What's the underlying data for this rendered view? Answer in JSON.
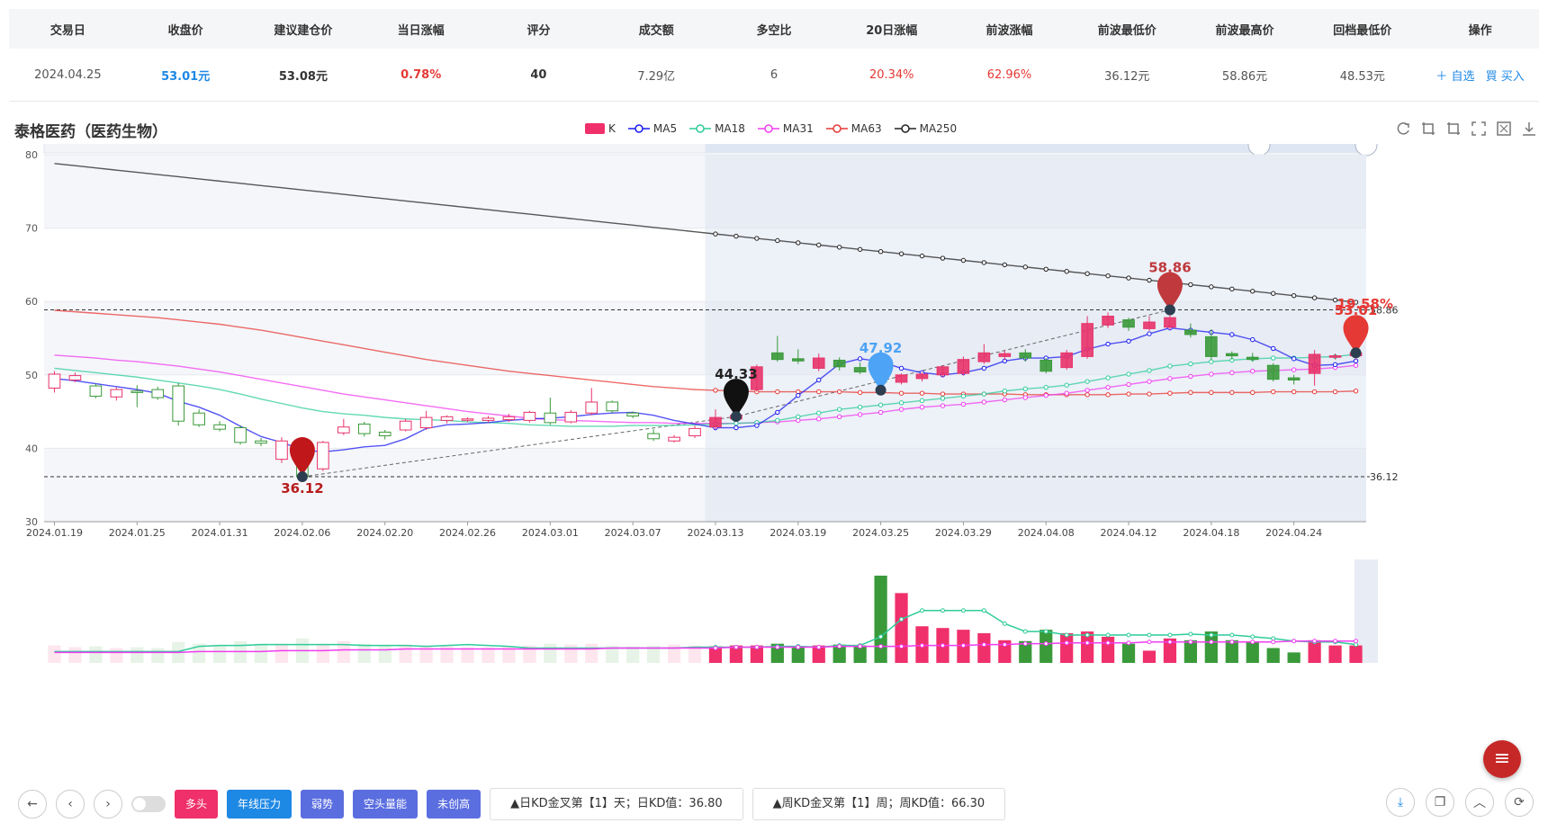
{
  "table": {
    "headers": [
      "交易日",
      "收盘价",
      "建议建仓价",
      "当日涨幅",
      "评分",
      "成交额",
      "多空比",
      "20日涨幅",
      "前波涨幅",
      "前波最低价",
      "前波最高价",
      "回档最低价",
      "操作"
    ],
    "row": {
      "date": "2024.04.25",
      "close": "53.01元",
      "suggest": "53.08元",
      "change": "0.78%",
      "score": "40",
      "turnover": "7.29亿",
      "ratio": "6",
      "chg20": "20.34%",
      "wave_chg": "62.96%",
      "wave_low": "36.12元",
      "wave_high": "58.86元",
      "pull_low": "48.53元",
      "action_watch": "＋ 自选",
      "action_buy": "買 买入"
    }
  },
  "stock_title": "泰格医药（医药生物）",
  "legend": [
    {
      "label": "K",
      "color": "#f0306a"
    },
    {
      "label": "MA5",
      "color": "#1b1bf0"
    },
    {
      "label": "MA18",
      "color": "#2ecc9a"
    },
    {
      "label": "MA31",
      "color": "#f03cf0"
    },
    {
      "label": "MA63",
      "color": "#e53935"
    },
    {
      "label": "MA250",
      "color": "#222222"
    }
  ],
  "icons": [
    "refresh-icon",
    "crop-icon",
    "crop-alt-icon",
    "fullscreen-icon",
    "restore-icon",
    "download-icon"
  ],
  "chart_data": {
    "type": "candlestick",
    "ylim": [
      30,
      80
    ],
    "yticks": [
      "80",
      "70",
      "60",
      "50",
      "40",
      "30"
    ],
    "xticks": [
      "2024.01.19",
      "2024.01.25",
      "2024.01.31",
      "2024.02.06",
      "2024.02.20",
      "2024.02.26",
      "2024.03.01",
      "2024.03.07",
      "2024.03.13",
      "2024.03.19",
      "2024.03.25",
      "2024.03.29",
      "2024.04.08",
      "2024.04.12",
      "2024.04.18",
      "2024.04.24"
    ],
    "candles": [
      [
        48.2,
        50.1,
        47.6,
        50.5
      ],
      [
        49.3,
        49.9,
        49.0,
        50.3
      ],
      [
        48.5,
        47.1,
        46.8,
        48.8
      ],
      [
        47.0,
        48.0,
        46.5,
        48.3
      ],
      [
        47.8,
        47.6,
        45.6,
        48.6
      ],
      [
        48.0,
        46.9,
        46.6,
        48.4
      ],
      [
        48.5,
        43.7,
        43.1,
        48.9
      ],
      [
        44.8,
        43.2,
        42.9,
        45.3
      ],
      [
        43.2,
        42.6,
        42.3,
        43.7
      ],
      [
        42.8,
        40.8,
        40.5,
        43.1
      ],
      [
        41.0,
        40.7,
        40.3,
        41.4
      ],
      [
        38.5,
        41.0,
        38.0,
        41.5
      ],
      [
        38.0,
        36.12,
        36.12,
        39.4
      ],
      [
        37.2,
        40.8,
        36.9,
        41.0
      ],
      [
        42.1,
        42.9,
        41.8,
        44.0
      ],
      [
        43.3,
        42.0,
        41.6,
        43.6
      ],
      [
        42.2,
        41.7,
        41.2,
        42.5
      ],
      [
        42.5,
        43.7,
        42.3,
        44.0
      ],
      [
        42.8,
        44.2,
        42.5,
        45.1
      ],
      [
        43.8,
        44.3,
        43.4,
        44.5
      ],
      [
        43.9,
        44.0,
        43.6,
        44.2
      ],
      [
        43.8,
        44.1,
        43.5,
        44.4
      ],
      [
        43.9,
        44.3,
        43.6,
        44.7
      ],
      [
        43.8,
        44.9,
        43.5,
        45.1
      ],
      [
        44.8,
        43.5,
        43.2,
        46.9
      ],
      [
        43.6,
        44.9,
        43.4,
        45.2
      ],
      [
        44.8,
        46.3,
        44.5,
        48.2
      ],
      [
        46.3,
        45.1,
        44.8,
        46.5
      ],
      [
        44.8,
        44.4,
        44.1,
        45.0
      ],
      [
        42.0,
        41.3,
        41.0,
        42.6
      ],
      [
        41.0,
        41.5,
        40.8,
        41.8
      ],
      [
        41.7,
        42.7,
        41.4,
        43.1
      ],
      [
        42.9,
        44.2,
        42.6,
        45.3
      ],
      [
        44.0,
        44.5,
        43.6,
        45.1
      ],
      [
        48.0,
        51.1,
        47.7,
        51.4
      ],
      [
        53.0,
        52.1,
        51.8,
        55.3
      ],
      [
        52.2,
        51.9,
        51.5,
        53.5
      ],
      [
        50.9,
        52.3,
        50.5,
        52.9
      ],
      [
        52.0,
        51.1,
        50.6,
        52.4
      ],
      [
        51.0,
        50.4,
        50.1,
        51.7
      ],
      [
        50.8,
        49.0,
        48.5,
        51.0
      ],
      [
        49.0,
        50.0,
        48.7,
        50.2
      ],
      [
        49.5,
        50.1,
        49.1,
        50.4
      ],
      [
        50.0,
        51.1,
        49.7,
        51.3
      ],
      [
        50.2,
        52.1,
        49.9,
        52.5
      ],
      [
        51.8,
        53.0,
        51.5,
        54.2
      ],
      [
        52.5,
        52.9,
        52.0,
        53.3
      ],
      [
        53.0,
        52.3,
        51.8,
        53.5
      ],
      [
        52.0,
        50.5,
        50.2,
        52.3
      ],
      [
        51.0,
        53.0,
        50.7,
        53.4
      ],
      [
        52.5,
        57.0,
        52.2,
        58.0
      ],
      [
        56.8,
        58.0,
        56.4,
        58.5
      ],
      [
        57.5,
        56.5,
        56.0,
        57.8
      ],
      [
        56.3,
        57.2,
        56.0,
        58.0
      ],
      [
        56.5,
        57.8,
        56.2,
        58.86
      ],
      [
        56.1,
        55.5,
        55.1,
        57.0
      ],
      [
        55.2,
        52.5,
        52.0,
        56.2
      ],
      [
        52.9,
        52.6,
        52.1,
        53.2
      ],
      [
        52.4,
        52.1,
        51.8,
        53.0
      ],
      [
        51.3,
        49.4,
        49.1,
        51.6
      ],
      [
        49.6,
        49.3,
        48.7,
        50.0
      ],
      [
        50.2,
        52.8,
        48.53,
        53.4
      ],
      [
        52.4,
        52.6,
        52.1,
        52.9
      ],
      [
        52.6,
        53.01,
        52.1,
        54.8
      ]
    ],
    "ma5": [
      49.5,
      49.2,
      48.8,
      48.4,
      48.0,
      47.5,
      46.4,
      45.6,
      44.5,
      43.0,
      41.6,
      40.8,
      39.8,
      39.5,
      39.8,
      40.2,
      40.4,
      41.3,
      42.7,
      43.2,
      43.3,
      43.5,
      43.8,
      44.0,
      44.1,
      44.3,
      44.6,
      44.8,
      44.9,
      44.5,
      43.8,
      43.3,
      42.8,
      42.8,
      43.1,
      44.9,
      47.2,
      49.3,
      51.5,
      52.2,
      51.8,
      50.9,
      50.3,
      50.0,
      50.3,
      50.9,
      51.9,
      52.3,
      52.3,
      52.5,
      53.5,
      54.2,
      54.6,
      55.6,
      56.4,
      56.1,
      55.8,
      55.5,
      54.8,
      53.6,
      52.2,
      51.3,
      51.4,
      51.9
    ],
    "ma18": [
      50.9,
      50.6,
      50.3,
      50.0,
      49.7,
      49.3,
      48.9,
      48.5,
      48.0,
      47.4,
      46.7,
      46.1,
      45.5,
      45.0,
      44.7,
      44.5,
      44.2,
      44.0,
      43.9,
      43.8,
      43.6,
      43.5,
      43.4,
      43.2,
      43.1,
      43.0,
      43.0,
      43.0,
      43.1,
      43.1,
      43.1,
      43.2,
      43.3,
      43.4,
      43.5,
      43.8,
      44.3,
      44.8,
      45.3,
      45.6,
      45.9,
      46.2,
      46.5,
      46.8,
      47.1,
      47.4,
      47.8,
      48.1,
      48.3,
      48.6,
      49.1,
      49.6,
      50.1,
      50.6,
      51.2,
      51.5,
      51.8,
      52.0,
      52.2,
      52.3,
      52.3,
      52.4,
      52.5,
      52.8
    ],
    "ma31": [
      52.7,
      52.5,
      52.3,
      52.0,
      51.8,
      51.5,
      51.2,
      50.8,
      50.4,
      49.9,
      49.4,
      48.9,
      48.4,
      47.9,
      47.4,
      47.0,
      46.6,
      46.2,
      45.8,
      45.4,
      45.0,
      44.7,
      44.4,
      44.1,
      43.9,
      43.8,
      43.7,
      43.6,
      43.5,
      43.5,
      43.4,
      43.4,
      43.4,
      43.4,
      43.5,
      43.6,
      43.8,
      44.0,
      44.3,
      44.6,
      44.9,
      45.3,
      45.6,
      45.8,
      46.0,
      46.3,
      46.6,
      46.9,
      47.2,
      47.5,
      47.9,
      48.3,
      48.7,
      49.1,
      49.5,
      49.8,
      50.1,
      50.3,
      50.5,
      50.6,
      50.7,
      50.8,
      51.0,
      51.3
    ],
    "ma63": [
      58.8,
      58.6,
      58.4,
      58.2,
      58.0,
      57.8,
      57.5,
      57.2,
      56.9,
      56.5,
      56.1,
      55.6,
      55.1,
      54.6,
      54.1,
      53.6,
      53.1,
      52.6,
      52.1,
      51.7,
      51.3,
      50.9,
      50.5,
      50.2,
      49.9,
      49.6,
      49.3,
      49.0,
      48.7,
      48.4,
      48.2,
      48.0,
      47.9,
      47.8,
      47.7,
      47.7,
      47.7,
      47.7,
      47.7,
      47.6,
      47.6,
      47.5,
      47.5,
      47.4,
      47.4,
      47.4,
      47.4,
      47.3,
      47.3,
      47.3,
      47.3,
      47.3,
      47.4,
      47.4,
      47.5,
      47.6,
      47.6,
      47.6,
      47.6,
      47.7,
      47.7,
      47.7,
      47.7,
      47.8
    ],
    "ma250": [
      78.8,
      78.5,
      78.2,
      77.9,
      77.6,
      77.3,
      77.0,
      76.7,
      76.4,
      76.1,
      75.8,
      75.5,
      75.2,
      74.9,
      74.6,
      74.3,
      74.0,
      73.7,
      73.4,
      73.1,
      72.8,
      72.5,
      72.2,
      71.9,
      71.6,
      71.3,
      71.0,
      70.7,
      70.4,
      70.1,
      69.8,
      69.5,
      69.2,
      68.9,
      68.6,
      68.3,
      68.0,
      67.7,
      67.4,
      67.1,
      66.8,
      66.5,
      66.2,
      65.9,
      65.6,
      65.3,
      65.0,
      64.7,
      64.4,
      64.1,
      63.8,
      63.5,
      63.2,
      62.9,
      62.6,
      62.3,
      62.0,
      61.7,
      61.4,
      61.1,
      60.8,
      60.5,
      60.2,
      59.9
    ],
    "volume": [
      0.2,
      0.18,
      0.19,
      0.17,
      0.18,
      0.17,
      0.24,
      0.22,
      0.2,
      0.25,
      0.22,
      0.22,
      0.28,
      0.22,
      0.25,
      0.22,
      0.2,
      0.21,
      0.2,
      0.19,
      0.18,
      0.18,
      0.19,
      0.2,
      0.22,
      0.21,
      0.22,
      0.2,
      0.19,
      0.2,
      0.21,
      0.2,
      0.19,
      0.2,
      0.2,
      0.22,
      0.18,
      0.2,
      0.21,
      0.2,
      1.0,
      0.8,
      0.42,
      0.4,
      0.38,
      0.34,
      0.26,
      0.25,
      0.38,
      0.34,
      0.36,
      0.3,
      0.22,
      0.14,
      0.28,
      0.26,
      0.36,
      0.26,
      0.24,
      0.17,
      0.12,
      0.26,
      0.2,
      0.2
    ],
    "vol_ma_a": [
      0.13,
      0.13,
      0.13,
      0.13,
      0.13,
      0.13,
      0.13,
      0.19,
      0.2,
      0.2,
      0.21,
      0.21,
      0.21,
      0.21,
      0.21,
      0.2,
      0.2,
      0.2,
      0.19,
      0.2,
      0.21,
      0.2,
      0.19,
      0.17,
      0.17,
      0.17,
      0.17,
      0.17,
      0.17,
      0.17,
      0.17,
      0.18,
      0.18,
      0.18,
      0.18,
      0.19,
      0.19,
      0.18,
      0.2,
      0.2,
      0.3,
      0.5,
      0.6,
      0.6,
      0.6,
      0.6,
      0.45,
      0.36,
      0.36,
      0.32,
      0.32,
      0.32,
      0.32,
      0.32,
      0.32,
      0.33,
      0.32,
      0.32,
      0.3,
      0.28,
      0.25,
      0.24,
      0.24,
      0.21
    ],
    "vol_ma_b": [
      0.12,
      0.12,
      0.12,
      0.12,
      0.12,
      0.12,
      0.12,
      0.13,
      0.13,
      0.13,
      0.13,
      0.14,
      0.14,
      0.14,
      0.15,
      0.15,
      0.15,
      0.16,
      0.16,
      0.16,
      0.16,
      0.16,
      0.16,
      0.16,
      0.16,
      0.16,
      0.16,
      0.17,
      0.17,
      0.17,
      0.17,
      0.17,
      0.17,
      0.18,
      0.18,
      0.18,
      0.18,
      0.18,
      0.19,
      0.19,
      0.19,
      0.19,
      0.2,
      0.2,
      0.2,
      0.21,
      0.21,
      0.22,
      0.22,
      0.23,
      0.23,
      0.23,
      0.23,
      0.24,
      0.24,
      0.24,
      0.24,
      0.24,
      0.24,
      0.24,
      0.25,
      0.25,
      0.25,
      0.25
    ],
    "markers": [
      {
        "label": "36.12",
        "value": 36.12,
        "index": 12,
        "color": "#c0171b",
        "text_color": "#b71c1c",
        "pos": "below"
      },
      {
        "label": "44.33",
        "value": 44.33,
        "index": 33,
        "color": "#111111",
        "text_color": "#222222",
        "pos": "above"
      },
      {
        "label": "47.92",
        "value": 47.92,
        "index": 40,
        "color": "#4da3f5",
        "text_color": "#4da3f5",
        "pos": "above"
      },
      {
        "label": "58.86",
        "value": 58.86,
        "index": 54,
        "color": "#c0393d",
        "text_color": "#c0393d",
        "pos": "above"
      },
      {
        "label": "53.01",
        "value": 53.01,
        "index": 63,
        "color": "#e53935",
        "text_color": "#e53935",
        "pos": "above"
      }
    ],
    "pct_label": "19.58%",
    "hline_high": "58.86",
    "hline_low": "36.12",
    "highlight_from_index": 32
  },
  "bottom": {
    "tags": [
      {
        "label": "多头",
        "color": "#f0306a"
      },
      {
        "label": "年线压力",
        "color": "#1e88e5"
      },
      {
        "label": "弱势",
        "color": "#5b6ee0"
      },
      {
        "label": "空头量能",
        "color": "#5b6ee0"
      },
      {
        "label": "未创高",
        "color": "#5b6ee0"
      }
    ],
    "info1": "▲日KD金叉第【1】天；日KD值：36.80",
    "info2": "▲周KD金叉第【1】周；周KD值：66.30"
  }
}
